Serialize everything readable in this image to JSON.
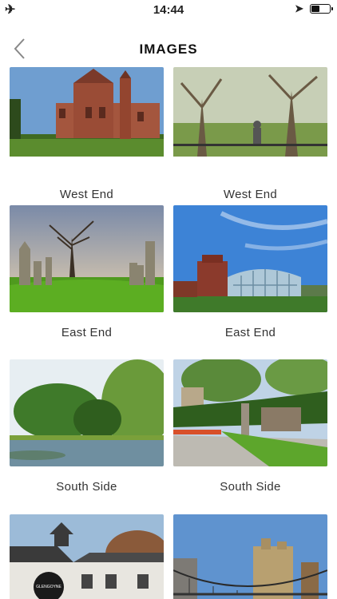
{
  "status_bar": {
    "time": "14:44",
    "airplane_icon": "airplane-icon",
    "location_icon": "location-arrow-icon",
    "battery_level": 0.4
  },
  "nav": {
    "title": "IMAGES",
    "back_icon": "chevron-left-icon"
  },
  "images": [
    {
      "label": "West End"
    },
    {
      "label": "West End"
    },
    {
      "label": "East End"
    },
    {
      "label": "East End"
    },
    {
      "label": "South Side"
    },
    {
      "label": "South Side"
    },
    {
      "label": ""
    },
    {
      "label": ""
    }
  ],
  "sign_text": "GLENGOYNE"
}
